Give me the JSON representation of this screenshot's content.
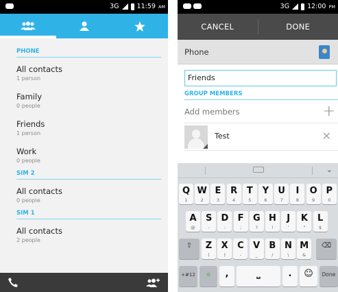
{
  "left": {
    "status": {
      "time": "11:59",
      "ampm": "AM",
      "network": "3G"
    },
    "tabs": [
      {
        "icon": "groups-icon",
        "active": true
      },
      {
        "icon": "person-icon",
        "active": false
      },
      {
        "icon": "star-icon",
        "active": false
      }
    ],
    "sections": [
      {
        "header": "PHONE",
        "items": [
          {
            "name": "All contacts",
            "count": "1 person"
          },
          {
            "name": "Family",
            "count": "0 people"
          },
          {
            "name": "Friends",
            "count": "1 person"
          },
          {
            "name": "Work",
            "count": "0 people"
          }
        ]
      },
      {
        "header": "SIM 2",
        "items": [
          {
            "name": "All contacts",
            "count": "0 people"
          }
        ]
      },
      {
        "header": "SIM 1",
        "items": [
          {
            "name": "All contacts",
            "count": "2 people"
          }
        ]
      }
    ],
    "bottom": {
      "left_icon": "phone-icon",
      "right_icon": "add-group-icon"
    }
  },
  "right": {
    "status": {
      "time": "12:00",
      "ampm": "PM",
      "network": "3G"
    },
    "actionbar": {
      "cancel": "CANCEL",
      "done": "DONE"
    },
    "account": {
      "label": "Phone",
      "icon": "contact-card-icon"
    },
    "group_name": "Friends",
    "members_header": "GROUP MEMBERS",
    "add_members_placeholder": "Add members",
    "members": [
      {
        "name": "Test"
      }
    ],
    "keyboard": {
      "row1": [
        {
          "k": "Q",
          "s": "1"
        },
        {
          "k": "W",
          "s": "2"
        },
        {
          "k": "E",
          "s": "3"
        },
        {
          "k": "R",
          "s": "4"
        },
        {
          "k": "T",
          "s": "5"
        },
        {
          "k": "Y",
          "s": "6"
        },
        {
          "k": "U",
          "s": "7"
        },
        {
          "k": "I",
          "s": "8"
        },
        {
          "k": "O",
          "s": "9"
        },
        {
          "k": "P",
          "s": "0"
        }
      ],
      "row2": [
        {
          "k": "A",
          "s": "@"
        },
        {
          "k": "S",
          "s": "-"
        },
        {
          "k": "D",
          "s": ":"
        },
        {
          "k": "F",
          "s": ";"
        },
        {
          "k": "G",
          "s": "?"
        },
        {
          "k": "H",
          "s": "!"
        },
        {
          "k": "J",
          "s": "'"
        },
        {
          "k": "K",
          "s": "\""
        },
        {
          "k": "L",
          "s": "$"
        }
      ],
      "row3": [
        {
          "k": "Z",
          "s": "("
        },
        {
          "k": "X",
          "s": ")"
        },
        {
          "k": "C",
          "s": "-"
        },
        {
          "k": "V",
          "s": "_"
        },
        {
          "k": "B",
          "s": "/"
        },
        {
          "k": "N",
          "s": "\\"
        },
        {
          "k": "M",
          "s": "&"
        }
      ],
      "symbols_key": "+#12",
      "comma_key": ",",
      "period_key": ".",
      "done_key": "Done"
    }
  },
  "colors": {
    "accent": "#2fb3e6",
    "actionbar": "#4a4a4a",
    "bottombar": "#3a3a3a"
  }
}
